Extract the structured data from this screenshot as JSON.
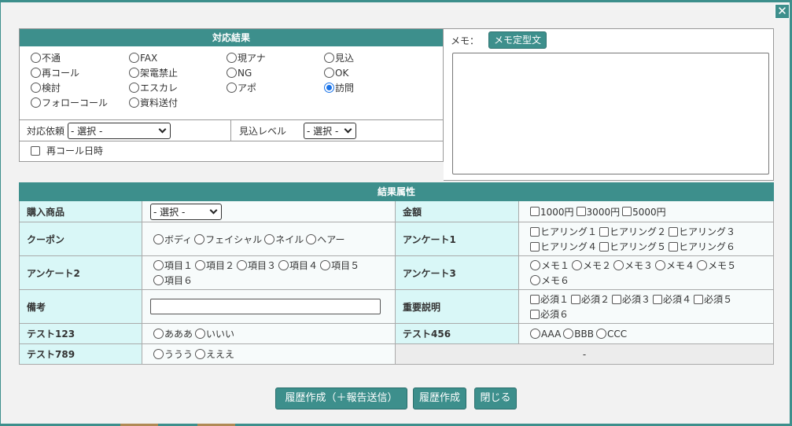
{
  "dialog": {
    "close_label": "✕"
  },
  "result": {
    "header": "対応結果",
    "options": [
      {
        "label": "不通",
        "checked": false
      },
      {
        "label": "FAX",
        "checked": false
      },
      {
        "label": "現アナ",
        "checked": false
      },
      {
        "label": "見込",
        "checked": false
      },
      {
        "label": "再コール",
        "checked": false
      },
      {
        "label": "架電禁止",
        "checked": false
      },
      {
        "label": "NG",
        "checked": false
      },
      {
        "label": "OK",
        "checked": false
      },
      {
        "label": "検討",
        "checked": false
      },
      {
        "label": "エスカレ",
        "checked": false
      },
      {
        "label": "アポ",
        "checked": false
      },
      {
        "label": "訪問",
        "checked": true
      },
      {
        "label": "フォローコール",
        "checked": false
      },
      {
        "label": "資料送付",
        "checked": false
      }
    ],
    "request_label": "対応依頼",
    "request_value": "- 選択 -",
    "level_label": "見込レベル",
    "level_value": "- 選択 -",
    "recall_label": "再コール日時"
  },
  "memo": {
    "label": "メモ：",
    "template_button": "メモ定型文"
  },
  "attributes": {
    "header": "結果属性",
    "product_label": "購入商品",
    "product_value": "- 選択 -",
    "amount_label": "金額",
    "amounts": [
      "1000円",
      "3000円",
      "5000円"
    ],
    "coupon_label": "クーポン",
    "coupons": [
      "ボディ",
      "フェイシャル",
      "ネイル",
      "ヘアー"
    ],
    "survey1_label": "アンケート1",
    "survey1": [
      "ヒアリング１",
      "ヒアリング２",
      "ヒアリング３",
      "ヒアリング４",
      "ヒアリング５",
      "ヒアリング６"
    ],
    "survey2_label": "アンケート2",
    "survey2": [
      "項目１",
      "項目２",
      "項目３",
      "項目４",
      "項目５",
      "項目６"
    ],
    "survey3_label": "アンケート3",
    "survey3": [
      "メモ１",
      "メモ２",
      "メモ３",
      "メモ４",
      "メモ５",
      "メモ６"
    ],
    "note_label": "備考",
    "important_label": "重要説明",
    "important": [
      "必須１",
      "必須２",
      "必須３",
      "必須４",
      "必須５",
      "必須６"
    ],
    "test123_label": "テスト123",
    "test123": [
      "あああ",
      "いいい"
    ],
    "test456_label": "テスト456",
    "test456": [
      "AAA",
      "BBB",
      "CCC"
    ],
    "test789_label": "テスト789",
    "test789": [
      "ううう",
      "えええ"
    ],
    "empty_value": "-"
  },
  "footer": {
    "create_send": "履歴作成（＋報告送信）",
    "create": "履歴作成",
    "close": "閉じる"
  },
  "colors": {
    "accent": "#3d8f8c",
    "label_bg": "#d9f7f7",
    "radio_checked": "#1a73e8"
  }
}
